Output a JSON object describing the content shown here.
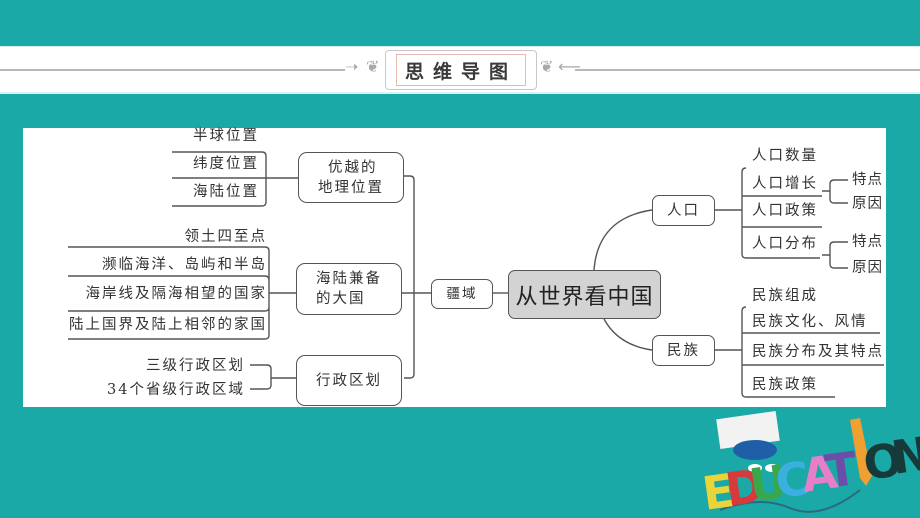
{
  "header": {
    "title": "思维导图",
    "ornament_left": "➝❦",
    "ornament_right": "❦⟵"
  },
  "mindmap": {
    "center": "从世界看中国",
    "left": {
      "root": "疆域",
      "branches": [
        {
          "label_line1": "优越的",
          "label_line2": "地理位置",
          "items": [
            "半球位置",
            "纬度位置",
            "海陆位置"
          ]
        },
        {
          "label_line1": "海陆兼备",
          "label_line2": "的大国",
          "items": [
            "领土四至点",
            "濒临海洋、岛屿和半岛",
            "海岸线及隔海相望的国家",
            "陆上国界及陆上相邻的家国"
          ]
        },
        {
          "label_line1": "行政区划",
          "label_line2": "",
          "items": [
            "三级行政区划",
            "34个省级行政区域"
          ]
        }
      ]
    },
    "right": [
      {
        "label": "人口",
        "items": [
          {
            "text": "人口数量",
            "sub": []
          },
          {
            "text": "人口增长",
            "sub": [
              "特点",
              "原因"
            ]
          },
          {
            "text": "人口政策",
            "sub": []
          },
          {
            "text": "人口分布",
            "sub": [
              "特点",
              "原因"
            ]
          }
        ]
      },
      {
        "label": "民族",
        "items": [
          {
            "text": "民族组成"
          },
          {
            "text": "民族文化、风情"
          },
          {
            "text": "民族分布及其特点"
          },
          {
            "text": "民族政策"
          }
        ]
      }
    ]
  },
  "decoration": {
    "letters": [
      "E",
      "D",
      "U",
      "C",
      "A",
      "T",
      "I",
      "O",
      "N"
    ],
    "letter_colors": [
      "#e9d43a",
      "#d63a3a",
      "#3aa84a",
      "#3ab0e0",
      "#e77fc8",
      "#6a4ea8",
      "#f0a030",
      "#163a3a",
      "#163a3a"
    ]
  },
  "colors": {
    "background": "#1ba9a8",
    "panel": "#ffffff",
    "line": "#555555",
    "center_fill": "#d3d3d3"
  }
}
